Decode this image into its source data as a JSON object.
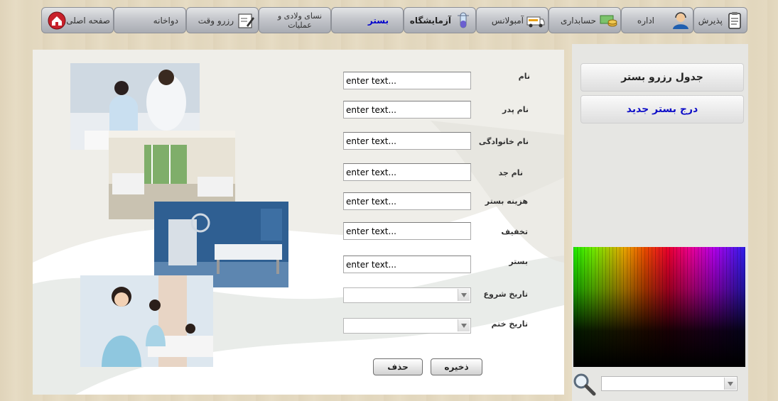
{
  "nav": {
    "items": [
      {
        "key": "reception",
        "label": "پذیرش",
        "icon": "clipboard-icon"
      },
      {
        "key": "office",
        "label": "اداره",
        "icon": "support-agent-icon"
      },
      {
        "key": "accounting",
        "label": "حسابداری",
        "icon": "money-stack-icon"
      },
      {
        "key": "ambulance",
        "label": "آمبولانس",
        "icon": "ambulance-icon"
      },
      {
        "key": "lab",
        "label": "آزمایشگاه",
        "icon": "test-tube-icon"
      },
      {
        "key": "bed",
        "label": "بستر",
        "icon": ""
      },
      {
        "key": "obstetrics",
        "label": "نسای ولادی و عملیات",
        "icon": ""
      },
      {
        "key": "appointment",
        "label": "رزرو وقت",
        "icon": "calendar-pen-icon"
      },
      {
        "key": "pharmacy",
        "label": "دواخانه",
        "icon": ""
      },
      {
        "key": "home",
        "label": "صفحه اصلی",
        "icon": "home-icon"
      }
    ]
  },
  "sidebar": {
    "reserve_table": "جدول رزرو بستر",
    "insert_new_bed": "درج بستر جدید"
  },
  "form": {
    "placeholder": "enter text...",
    "fields": {
      "first_name": "نام",
      "father_name": "نام پدر",
      "last_name": "نام خانوادگی",
      "grandfather_name": "نام جد",
      "bed_cost": "هزینه بستر",
      "discount": "تخفیف",
      "bed": "بستر",
      "start_date": "تاریخ شروع",
      "end_date": "تاریخ ختم"
    }
  },
  "buttons": {
    "save": "ذخیره",
    "delete": "حذف"
  },
  "colors": {
    "active_nav": "#0000cc",
    "insert_link": "#1010c8",
    "panel_bg": "#efeee9"
  }
}
